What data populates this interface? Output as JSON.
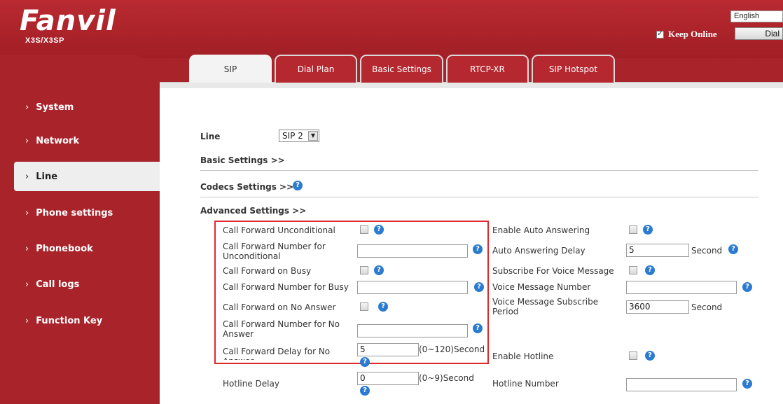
{
  "header": {
    "brand": "Fanvil",
    "model": "X3S/X3SP",
    "language": "English",
    "keep_online_label": "Keep Online",
    "keep_online_checked": true,
    "dial_label": "Dial"
  },
  "sidebar": {
    "items": [
      {
        "label": "System"
      },
      {
        "label": "Network"
      },
      {
        "label": "Line"
      },
      {
        "label": "Phone settings"
      },
      {
        "label": "Phonebook"
      },
      {
        "label": "Call logs"
      },
      {
        "label": "Function Key"
      }
    ],
    "active": "Line"
  },
  "tabs": [
    {
      "label": "SIP"
    },
    {
      "label": "Dial Plan"
    },
    {
      "label": "Basic Settings"
    },
    {
      "label": "RTCP-XR"
    },
    {
      "label": "SIP Hotspot"
    }
  ],
  "active_tab": "SIP",
  "form": {
    "line_label": "Line",
    "line_value": "SIP 2",
    "basic_settings": "Basic Settings >>",
    "codecs_settings": "Codecs Settings >>",
    "advanced_settings": "Advanced Settings >>",
    "left": {
      "cfu_label": "Call Forward Unconditional",
      "cfu_number_label": "Call Forward Number for Unconditional",
      "cfu_number_value": "",
      "cfb_label": "Call Forward on Busy",
      "cfb_number_label": "Call Forward Number for Busy",
      "cfb_number_value": "",
      "cfna_label": "Call Forward on No Answer",
      "cfna_number_label": "Call Forward Number for No Answer",
      "cfna_number_value": "",
      "cf_delay_label": "Call Forward Delay for No Answer",
      "cf_delay_value": "5",
      "cf_delay_hint": "(0~120)Second",
      "hotline_delay_label": "Hotline Delay",
      "hotline_delay_value": "0",
      "hotline_delay_hint": "(0~9)Second"
    },
    "right": {
      "auto_answer_label": "Enable Auto Answering",
      "auto_answer_delay_label": "Auto Answering Delay",
      "auto_answer_delay_value": "5",
      "auto_answer_delay_unit": "Second",
      "subscribe_vm_label": "Subscribe For Voice Message",
      "vm_number_label": "Voice Message Number",
      "vm_number_value": "",
      "vm_period_label": "Voice Message Subscribe Period",
      "vm_period_value": "3600",
      "vm_period_unit": "Second",
      "hotline_label": "Enable Hotline",
      "hotline_number_label": "Hotline Number",
      "hotline_number_value": ""
    },
    "help_glyph": "?"
  },
  "colors": {
    "brand_red": "#a9232a",
    "highlight_red": "#e0292f",
    "help_blue": "#2b7bd0"
  }
}
